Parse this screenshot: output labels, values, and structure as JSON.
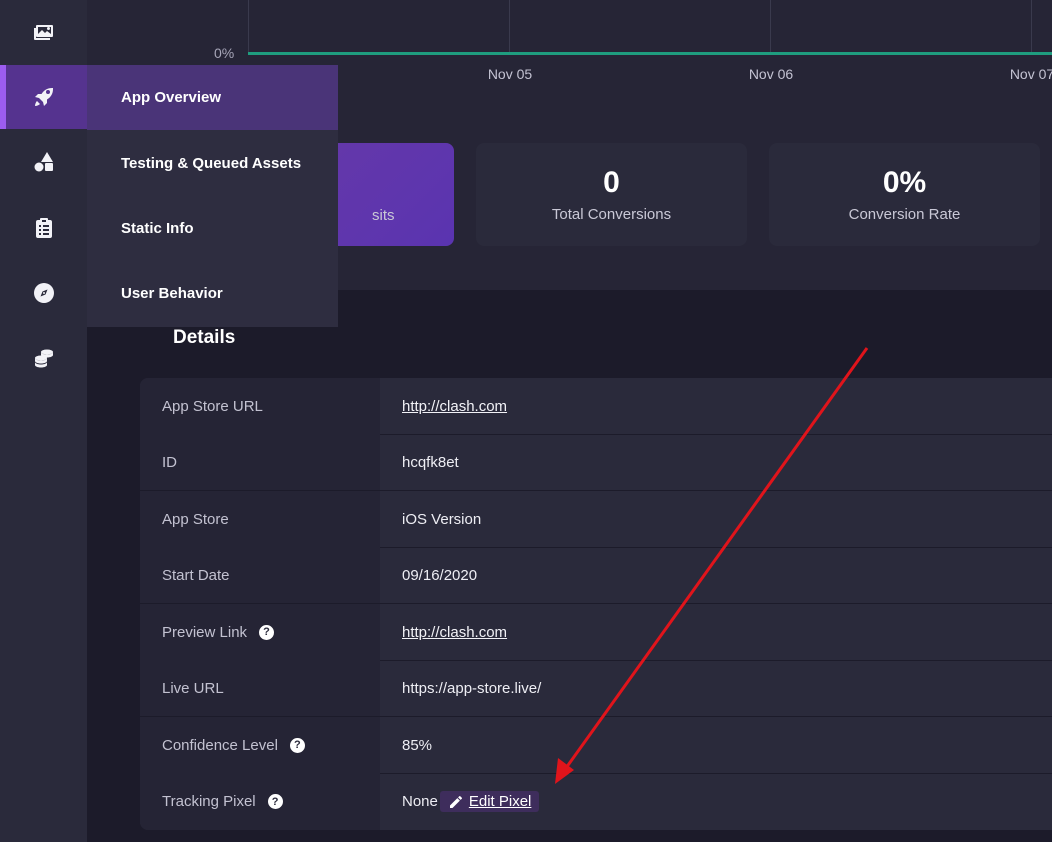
{
  "chart": {
    "y_tick": "0%",
    "x_ticks": [
      "Nov 05",
      "Nov 06",
      "Nov 07"
    ]
  },
  "nav": {
    "items": [
      {
        "label": "App Overview",
        "icon": "rocket-icon",
        "active": true
      },
      {
        "label": "Testing & Queued Assets",
        "icon": "shapes-icon",
        "active": false
      },
      {
        "label": "Static Info",
        "icon": "clipboard-icon",
        "active": false
      },
      {
        "label": "User Behavior",
        "icon": "compass-icon",
        "active": false
      }
    ],
    "rail_icons": [
      "images-icon",
      "rocket-icon",
      "shapes-icon",
      "clipboard-icon",
      "compass-icon",
      "coins-icon"
    ]
  },
  "stats": [
    {
      "value": "",
      "label": "sits"
    },
    {
      "value": "0",
      "label": "Total Conversions"
    },
    {
      "value": "0%",
      "label": "Conversion Rate"
    }
  ],
  "details": {
    "title": "Details",
    "rows": [
      {
        "key": "App Store URL",
        "value": "http://clash.com",
        "link": true,
        "help": false
      },
      {
        "key": "ID",
        "value": "hcqfk8et",
        "link": false,
        "help": false
      },
      {
        "key": "App Store",
        "value": "iOS Version",
        "link": false,
        "help": false
      },
      {
        "key": "Start Date",
        "value": "09/16/2020",
        "link": false,
        "help": false
      },
      {
        "key": "Preview Link",
        "value": "http://clash.com",
        "link": true,
        "help": true
      },
      {
        "key": "Live URL",
        "value": "https://app-store.live/",
        "link": false,
        "help": false
      },
      {
        "key": "Confidence Level",
        "value": "85%",
        "link": false,
        "help": true
      },
      {
        "key": "Tracking Pixel",
        "value": "None",
        "link": false,
        "help": true,
        "action": "Edit Pixel"
      }
    ]
  },
  "colors": {
    "accent": "#9c5cf0",
    "chart_line": "#1f9d7f",
    "annotation_arrow": "#e0141b"
  }
}
